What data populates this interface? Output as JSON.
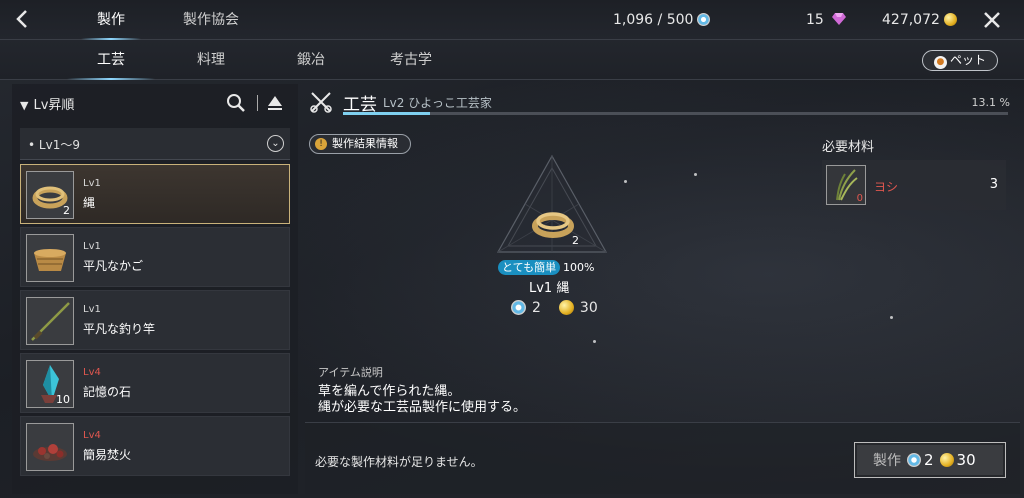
{
  "topbar": {
    "tabs": [
      {
        "label": "製作"
      },
      {
        "label": "製作協会"
      }
    ],
    "energy_value": "1,096 / 500",
    "gems": "15",
    "gold": "427,072"
  },
  "subtabs": [
    {
      "label": "工芸"
    },
    {
      "label": "料理"
    },
    {
      "label": "鍛冶"
    },
    {
      "label": "考古学"
    }
  ],
  "pet_button": "ペット",
  "sort": {
    "label": "Lv昇順"
  },
  "group": {
    "label": "Lv1〜9"
  },
  "items": [
    {
      "level": "Lv1",
      "name": "縄",
      "count": "2"
    },
    {
      "level": "Lv1",
      "name": "平凡なかご",
      "count": ""
    },
    {
      "level": "Lv1",
      "name": "平凡な釣り竿",
      "count": ""
    },
    {
      "level": "Lv4",
      "name": "記憶の石",
      "count": "10"
    },
    {
      "level": "Lv4",
      "name": "簡易焚火",
      "count": ""
    }
  ],
  "craft": {
    "title": "工芸",
    "level": "Lv2 ひよっこ工芸家",
    "progress_pct": "13.1 %",
    "progress_value": 13.1
  },
  "info_button": "製作結果情報",
  "result": {
    "count": "2",
    "difficulty": "とても簡単",
    "success": "100%",
    "name": "Lv1 縄",
    "energy_cost": "2",
    "gold_cost": "30"
  },
  "materials": {
    "header": "必要材料",
    "items": [
      {
        "name": "ヨシ",
        "have": "0",
        "qty": "3"
      }
    ]
  },
  "description": {
    "label": "アイテム説明",
    "lines": [
      "草を編んで作られた縄。",
      "縄が必要な工芸品製作に使用する。"
    ]
  },
  "bottom": {
    "message": "必要な製作材料が足りません。",
    "craft_label": "製作",
    "energy": "2",
    "gold": "30"
  },
  "colors": {
    "accent": "#7fd0f0",
    "selected_border": "#c9b27a",
    "warning": "#e0574f",
    "badge": "#1a8fc0"
  }
}
